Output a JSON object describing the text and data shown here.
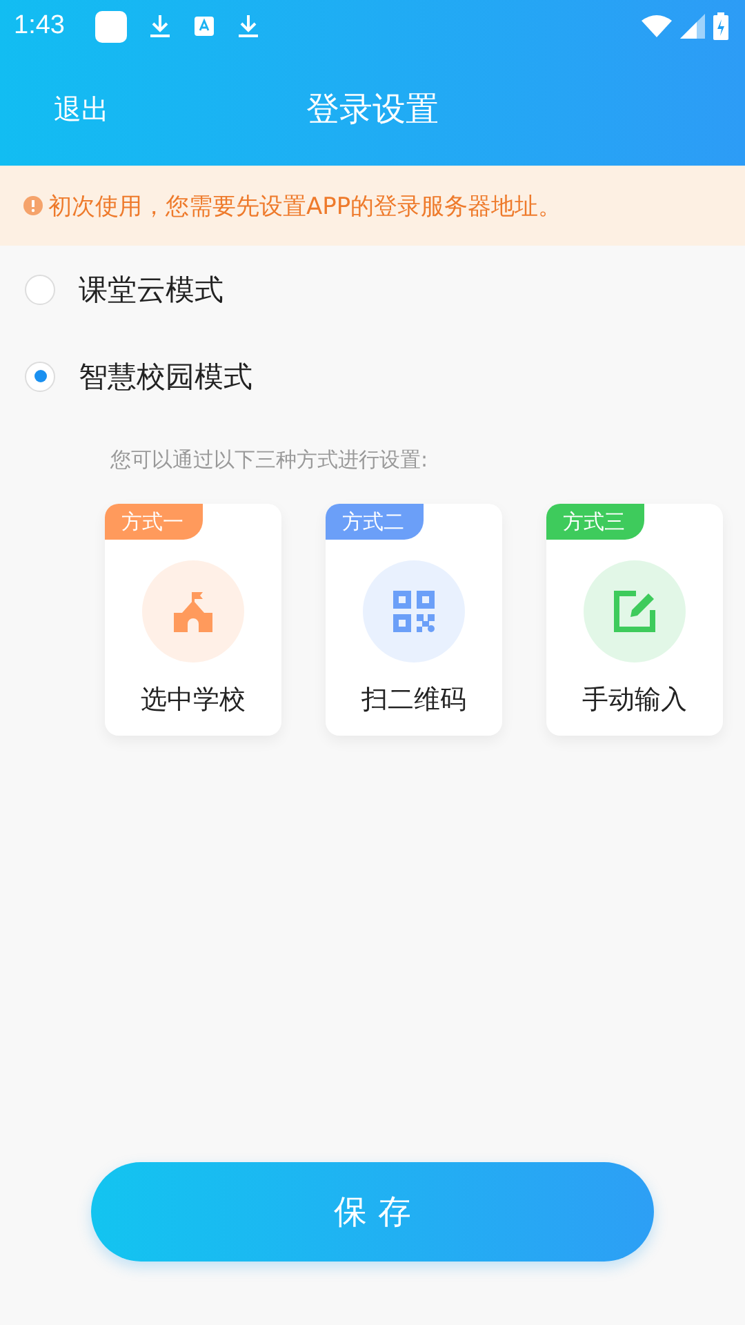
{
  "status_bar": {
    "time": "1:43"
  },
  "header": {
    "back": "退出",
    "title": "登录设置"
  },
  "notice": {
    "text": "初次使用，您需要先设置APP的登录服务器地址。"
  },
  "modes": [
    {
      "label": "课堂云模式",
      "selected": false
    },
    {
      "label": "智慧校园模式",
      "selected": true
    }
  ],
  "hint": "您可以通过以下三种方式进行设置:",
  "methods": [
    {
      "tag": "方式一",
      "label": "选中学校",
      "kind": "school",
      "color": "#ff9a5c"
    },
    {
      "tag": "方式二",
      "label": "扫二维码",
      "kind": "qr",
      "color": "#6b9ff8"
    },
    {
      "tag": "方式三",
      "label": "手动输入",
      "kind": "edit",
      "color": "#3ecb5c"
    }
  ],
  "save_button": "保 存"
}
